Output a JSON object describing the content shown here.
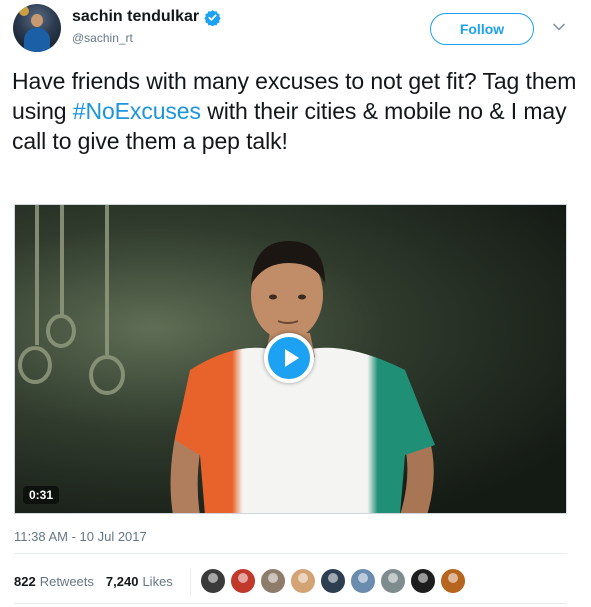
{
  "author": {
    "display_name": "sachin tendulkar",
    "handle": "@sachin_rt",
    "verified": true
  },
  "follow_label": "Follow",
  "tweet": {
    "text_before": "Have friends with many excuses to not get fit? Tag them using ",
    "hashtag": "#NoExcuses",
    "text_after": " with their cities & mobile no & I may call to give them a pep talk!"
  },
  "video": {
    "duration": "0:31"
  },
  "timestamp": "11:38 AM - 10 Jul 2017",
  "stats": {
    "retweets_count": "822",
    "retweets_label": "Retweets",
    "likes_count": "7,240",
    "likes_label": "Likes"
  },
  "liker_avatars": [
    "#3a3a3a",
    "#c0392b",
    "#8e7c6a",
    "#d4a373",
    "#2c3e50",
    "#6a8caf",
    "#7f8c8d",
    "#1d1d1d",
    "#b5651d"
  ],
  "colors": {
    "accent": "#1da1f2",
    "hashtag": "#1b95e0",
    "secondary_text": "#657786"
  }
}
